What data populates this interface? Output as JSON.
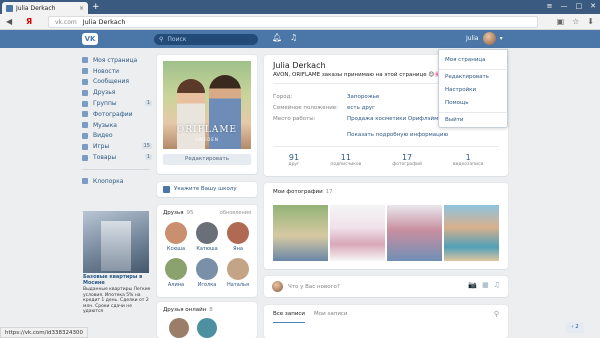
{
  "browser": {
    "tab_title": "Julia Derkach",
    "tab_close": "×",
    "new_tab": "+",
    "search_logo": "Я",
    "url_domain": "vk.com",
    "url_title": "Julia Derkach",
    "window_controls": [
      "≡",
      "—",
      "□",
      "✕"
    ],
    "addr_icons": [
      "▣",
      "☆",
      "⬇"
    ],
    "status_url": "https://vk.com/id338324300"
  },
  "header": {
    "logo": "VK",
    "search_placeholder": "Поиск",
    "user_short_name": "Julia"
  },
  "left_menu": [
    {
      "label": "Моя страница",
      "icon": "home-icon"
    },
    {
      "label": "Новости",
      "icon": "news-icon"
    },
    {
      "label": "Сообщения",
      "icon": "messages-icon"
    },
    {
      "label": "Друзья",
      "icon": "friends-icon"
    },
    {
      "label": "Группы",
      "icon": "groups-icon",
      "count": "1"
    },
    {
      "label": "Фотографии",
      "icon": "photos-icon"
    },
    {
      "label": "Музыка",
      "icon": "music-icon"
    },
    {
      "label": "Видео",
      "icon": "video-icon"
    },
    {
      "label": "Игры",
      "icon": "games-icon",
      "count": "15"
    },
    {
      "label": "Товары",
      "icon": "goods-icon",
      "count": "1"
    }
  ],
  "left_menu_extra": {
    "label": "Клопорка",
    "icon": "app-icon"
  },
  "ad": {
    "title": "Базовые квартиры в Мосине",
    "text": "Выданные квартиры Легкие условия. Ипотека 5% на кредит 1 день. Сделки от 2 млн. Сроки сдачи не удаются"
  },
  "avatar_card": {
    "brand": "ORIFLAME",
    "brand_sub": "SWEDEN",
    "edit_label": "Редактировать"
  },
  "school": {
    "label": "Укажите Вашу школу"
  },
  "friends": {
    "title": "Друзья",
    "count": "95",
    "updates_label": "обновления",
    "items": [
      {
        "name": "Ксюша",
        "color": "#c98f6e"
      },
      {
        "name": "Катюша",
        "color": "#6a6f7a"
      },
      {
        "name": "Яна",
        "color": "#b06a54"
      },
      {
        "name": "Алина",
        "color": "#8aa36e"
      },
      {
        "name": "Иголка",
        "color": "#7a8fa8"
      },
      {
        "name": "Наталья",
        "color": "#c4a486"
      }
    ]
  },
  "friends_online": {
    "title": "Друзья онлайн",
    "count": "8"
  },
  "profile": {
    "name": "Julia Derkach",
    "status": "AVON, ORIFLAME заказы принимаю на этой странице 😊🌸",
    "rows": [
      {
        "key": "Город:",
        "value": "Запорожье"
      },
      {
        "key": "Семейное положение:",
        "value": "есть друг"
      },
      {
        "key": "Место работы:",
        "value": "Продажа косметики Орифлэйм, AVON"
      }
    ],
    "more_label": "Показать подробную информацию",
    "counters": [
      {
        "num": "91",
        "label": "друг"
      },
      {
        "num": "11",
        "label": "подписчиков"
      },
      {
        "num": "17",
        "label": "фотографий"
      },
      {
        "num": "1",
        "label": "видеозаписи"
      }
    ]
  },
  "photos": {
    "title": "Мои фотографии",
    "count": "17"
  },
  "post": {
    "placeholder": "Что у Вас нового?",
    "icons": [
      "📷",
      "▦",
      "♫"
    ]
  },
  "wall": {
    "tab_all": "Все записи",
    "tab_mine": "Мои записи",
    "search_icon": "⚲"
  },
  "dropdown": {
    "items": [
      "Моя страница",
      "Редактировать",
      "Настройки",
      "Помощь",
      "Выйти"
    ]
  },
  "pager": {
    "label": "‹ 2"
  },
  "colors": {
    "vk_blue": "#4a76a8",
    "link": "#2a5885",
    "background": "#edeef0"
  }
}
